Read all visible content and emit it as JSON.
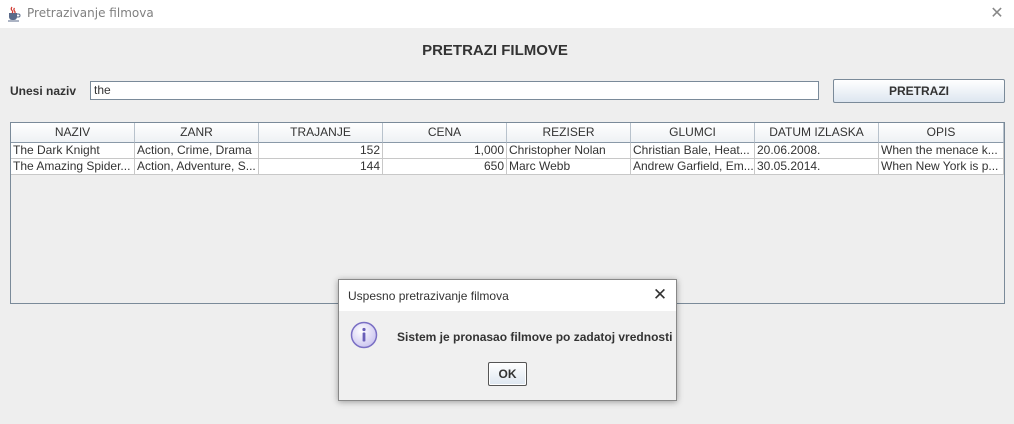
{
  "window": {
    "title": "Pretrazivanje filmova",
    "close_glyph": "✕",
    "icon": "java-coffee-cup-icon"
  },
  "heading": "PRETRAZI FILMOVE",
  "search": {
    "label": "Unesi naziv",
    "value": "the",
    "button_label": "PRETRAZI"
  },
  "table": {
    "columns": [
      "NAZIV",
      "ZANR",
      "TRAJANJE",
      "CENA",
      "REZISER",
      "GLUMCI",
      "DATUM IZLASKA",
      "OPIS"
    ],
    "rows": [
      [
        "The Dark Knight",
        "Action, Crime, Drama",
        "152",
        "1,000",
        "Christopher Nolan",
        "Christian Bale, Heat...",
        "20.06.2008.",
        "When the menace k..."
      ],
      [
        "The Amazing Spider...",
        "Action, Adventure, S...",
        "144",
        "650",
        "Marc Webb",
        "Andrew Garfield, Em...",
        "30.05.2014.",
        "When New York is p..."
      ]
    ]
  },
  "dialog": {
    "title": "Uspesno pretrazivanje filmova",
    "close_glyph": "✕",
    "icon": "info-icon",
    "message": "Sistem je pronasao filmove po zadatoj vrednosti",
    "ok_label": "OK",
    "ok_mnemonic": "K"
  },
  "colors": {
    "window_background": "#eeeeee",
    "border": "#7a8a99",
    "info_icon": "#7a6fc4"
  }
}
